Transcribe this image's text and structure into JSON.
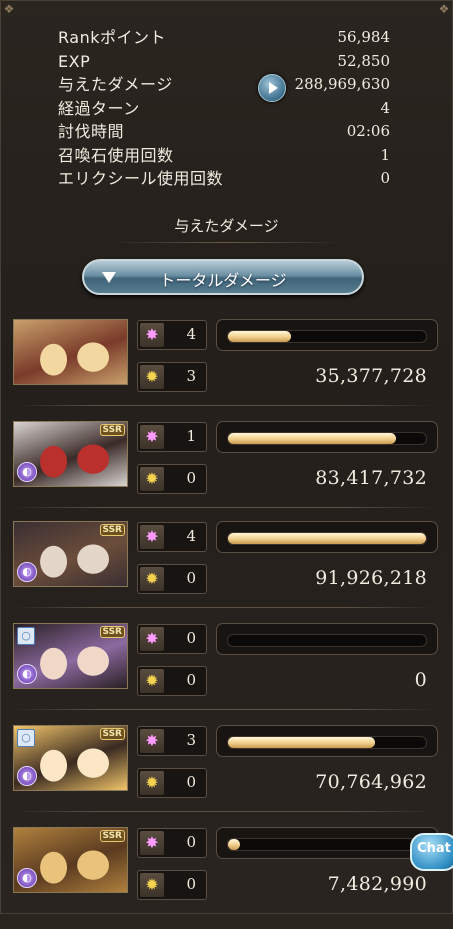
{
  "stats": [
    {
      "label": "Rankポイント",
      "value": "56,984"
    },
    {
      "label": "EXP",
      "value": "52,850"
    },
    {
      "label": "与えたダメージ",
      "value": "288,969,630"
    },
    {
      "label": "経過ターン",
      "value": "4"
    },
    {
      "label": "討伐時間",
      "value": "02:06"
    },
    {
      "label": "召喚石使用回数",
      "value": "1"
    },
    {
      "label": "エリクシール使用回数",
      "value": "0"
    }
  ],
  "section_title": "与えたダメージ",
  "total_button_label": "トータルダメージ",
  "ssr_label": "SSR",
  "chat_label": "Chat",
  "characters": [
    {
      "name": "main-character",
      "skills": "4",
      "ougi": "3",
      "damage": "35,377,728",
      "gauge": 0.32,
      "ssr": false,
      "element": false,
      "ring": false,
      "palette": [
        "#c9a06b",
        "#f3d7a0",
        "#7a3b2a"
      ]
    },
    {
      "name": "character-2",
      "skills": "1",
      "ougi": "0",
      "damage": "83,417,732",
      "gauge": 0.85,
      "ssr": true,
      "element": true,
      "ring": false,
      "palette": [
        "#d9d4d0",
        "#b9302c",
        "#3a2a28"
      ]
    },
    {
      "name": "character-3",
      "skills": "4",
      "ougi": "0",
      "damage": "91,926,218",
      "gauge": 1.0,
      "ssr": true,
      "element": true,
      "ring": false,
      "palette": [
        "#3a2f33",
        "#e3d5c8",
        "#6b4d3a"
      ]
    },
    {
      "name": "character-4",
      "skills": "0",
      "ougi": "0",
      "damage": "0",
      "gauge": 0.0,
      "ssr": true,
      "element": true,
      "ring": true,
      "palette": [
        "#2a2024",
        "#f0d8c8",
        "#8c6aa0"
      ]
    },
    {
      "name": "character-5",
      "skills": "3",
      "ougi": "0",
      "damage": "70,764,962",
      "gauge": 0.74,
      "ssr": true,
      "element": true,
      "ring": true,
      "palette": [
        "#f1c56a",
        "#fbe6c6",
        "#3a2a20"
      ]
    },
    {
      "name": "character-6",
      "skills": "0",
      "ougi": "0",
      "damage": "7,482,990",
      "gauge": 0.06,
      "ssr": true,
      "element": true,
      "ring": false,
      "palette": [
        "#b0813e",
        "#e9c27b",
        "#5a3a1f"
      ]
    }
  ],
  "icons": {
    "skill": "magic-star-icon",
    "ougi": "ougi-burst-icon",
    "element": "dark-element-icon",
    "ring": "ring-icon",
    "play": "play-icon"
  }
}
